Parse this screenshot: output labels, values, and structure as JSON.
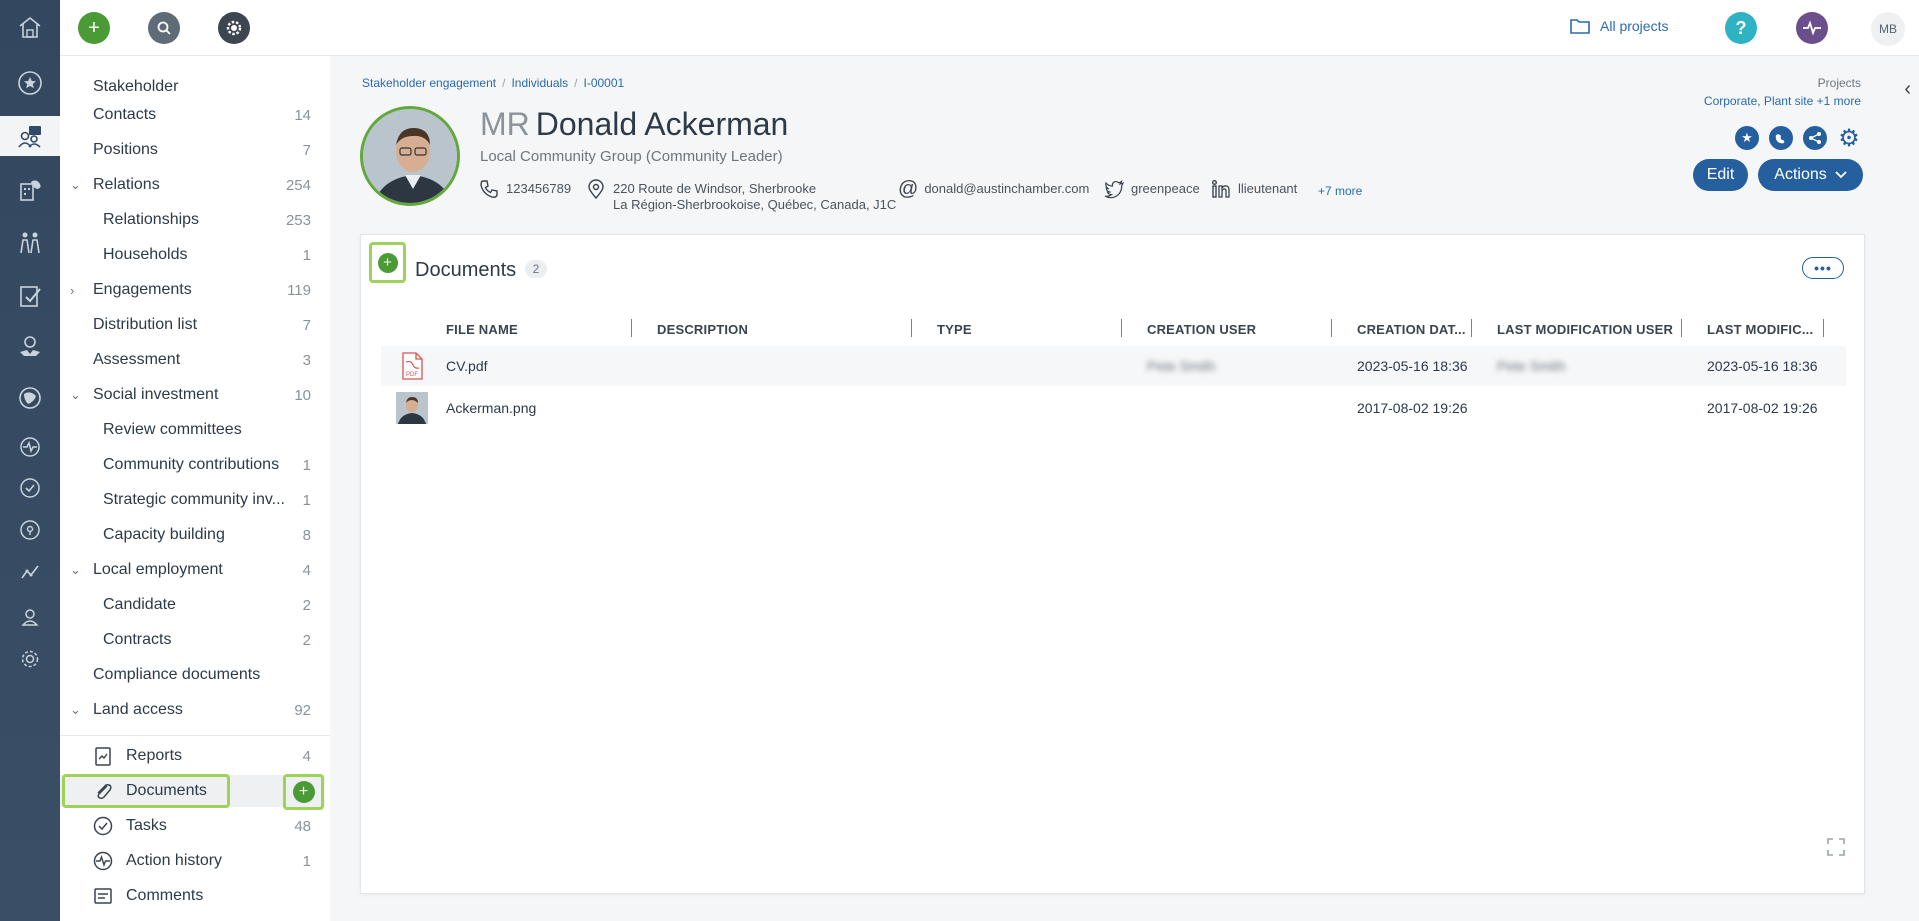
{
  "topbar": {
    "all_projects_label": "All projects",
    "avatar_initials": "MB"
  },
  "sidebar": {
    "items": [
      {
        "label": "Stakeholder",
        "count": ""
      },
      {
        "label": "Contacts",
        "count": "14"
      },
      {
        "label": "Positions",
        "count": "7"
      },
      {
        "label": "Relations",
        "count": "254"
      },
      {
        "label": "Relationships",
        "count": "253"
      },
      {
        "label": "Households",
        "count": "1"
      },
      {
        "label": "Engagements",
        "count": "119"
      },
      {
        "label": "Distribution list",
        "count": "7"
      },
      {
        "label": "Assessment",
        "count": "3"
      },
      {
        "label": "Social investment",
        "count": "10"
      },
      {
        "label": "Review committees",
        "count": ""
      },
      {
        "label": "Community contributions",
        "count": "1"
      },
      {
        "label": "Strategic community inv...",
        "count": "1"
      },
      {
        "label": "Capacity building",
        "count": "8"
      },
      {
        "label": "Local employment",
        "count": "4"
      },
      {
        "label": "Candidate",
        "count": "2"
      },
      {
        "label": "Contracts",
        "count": "2"
      },
      {
        "label": "Compliance documents",
        "count": ""
      },
      {
        "label": "Land access",
        "count": "92"
      },
      {
        "label": "Reports",
        "count": "4"
      },
      {
        "label": "Documents",
        "count": ""
      },
      {
        "label": "Tasks",
        "count": "48"
      },
      {
        "label": "Action history",
        "count": "1"
      },
      {
        "label": "Comments",
        "count": ""
      }
    ]
  },
  "breadcrumb": {
    "items": [
      "Stakeholder engagement",
      "Individuals",
      "I-00001"
    ],
    "separator": "/"
  },
  "profile": {
    "prefix": "MR",
    "name": "Donald Ackerman",
    "subtitle": "Local Community Group (Community Leader)",
    "phone": "123456789",
    "address_line1": "220 Route de Windsor, Sherbrooke",
    "address_line2": "La Région-Sherbrookoise, Québec, Canada, J1C",
    "email": "donald@austinchamber.com",
    "twitter": "greenpeace",
    "linkedin": "llieutenant",
    "more": "+7 more"
  },
  "projects": {
    "title": "Projects",
    "value": "Corporate, Plant site",
    "more": "+1 more"
  },
  "actions": {
    "edit_label": "Edit",
    "actions_label": "Actions"
  },
  "documents": {
    "title": "Documents",
    "count": "2",
    "columns": [
      "FILE NAME",
      "DESCRIPTION",
      "TYPE",
      "CREATION USER",
      "CREATION DAT...",
      "LAST MODIFICATION USER",
      "LAST MODIFIC..."
    ],
    "rows": [
      {
        "icon": "pdf-file-icon",
        "file": "CV.pdf",
        "description": "",
        "type": "",
        "creation_user": "Pete Smith",
        "creation_date": "2023-05-16 18:36",
        "mod_user": "Pete Smith",
        "mod_date": "2023-05-16 18:36"
      },
      {
        "icon": "image-thumbnail",
        "file": "Ackerman.png",
        "description": "",
        "type": "",
        "creation_user": "",
        "creation_date": "2017-08-02 19:26",
        "mod_user": "",
        "mod_date": "2017-08-02 19:26"
      }
    ]
  },
  "colors": {
    "rail_bg": "#33475e",
    "accent_blue": "#255f9e",
    "link_blue": "#2a6ab0",
    "green": "#4a9a35",
    "highlight": "#9fd25a",
    "help_teal": "#2fb3c4",
    "activity_purple": "#6a4f8c"
  }
}
